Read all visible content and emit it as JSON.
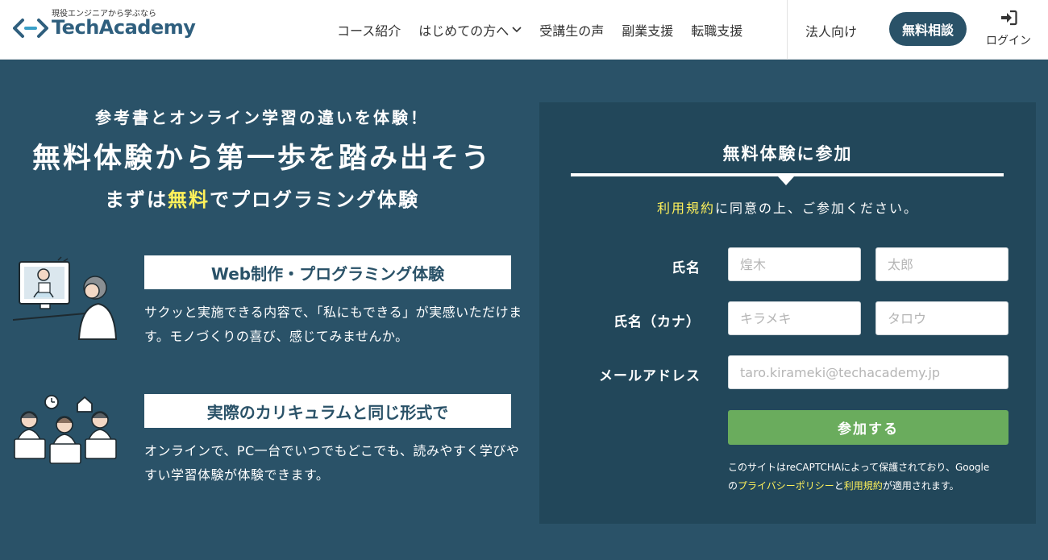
{
  "header": {
    "tagline": "現役エンジニアから学ぶなら",
    "logo_text": "TechAcademy",
    "nav": [
      {
        "label": "コース紹介",
        "dropdown": false
      },
      {
        "label": "はじめての方へ",
        "dropdown": true
      },
      {
        "label": "受講生の声",
        "dropdown": false
      },
      {
        "label": "副業支援",
        "dropdown": false
      },
      {
        "label": "転職支援",
        "dropdown": false
      }
    ],
    "corporate_label": "法人向け",
    "consult_label": "無料相談",
    "login_label": "ログイン",
    "login_icon": "login-icon"
  },
  "hero": {
    "subtitle": "参考書とオンライン学習の違いを体験！",
    "title": "無料体験から第一歩を踏み出そう",
    "line_prefix": "まずは",
    "line_highlight": "無料",
    "line_suffix": "でプログラミング体験"
  },
  "features": [
    {
      "icon": "video-lesson-illustration",
      "heading": "Web制作・プログラミング体験",
      "text": "サクッと実施できる内容で、「私にもできる」が実感いただけます。モノづくりの喜び、感じてみませんか。"
    },
    {
      "icon": "remote-learners-illustration",
      "heading": "実際のカリキュラムと同じ形式で",
      "text": "オンラインで、PC一台でいつでもどこでも、読みやすく学びやすい学習体験が体験できます。"
    }
  ],
  "form": {
    "title": "無料体験に参加",
    "terms_link": "利用規約",
    "terms_rest": "に同意の上、ご参加ください。",
    "name_label": "氏名",
    "last_name_placeholder": "煌木",
    "first_name_placeholder": "太郎",
    "kana_label": "氏名（カナ）",
    "last_kana_placeholder": "キラメキ",
    "first_kana_placeholder": "タロウ",
    "email_label": "メールアドレス",
    "email_placeholder": "taro.kirameki@techacademy.jp",
    "submit_label": "参加する",
    "recaptcha_line1": "このサイトはreCAPTCHAによって保護されており、Google",
    "recaptcha_pre": "の",
    "privacy_link": "プライバシーポリシー",
    "recaptcha_and": "と",
    "terms_link2": "利用規約",
    "recaptcha_post": "が適用されます。"
  },
  "colors": {
    "brand": "#2a5268",
    "panel": "#22475a",
    "highlight": "#fff15a",
    "submit": "#6aac5d"
  }
}
